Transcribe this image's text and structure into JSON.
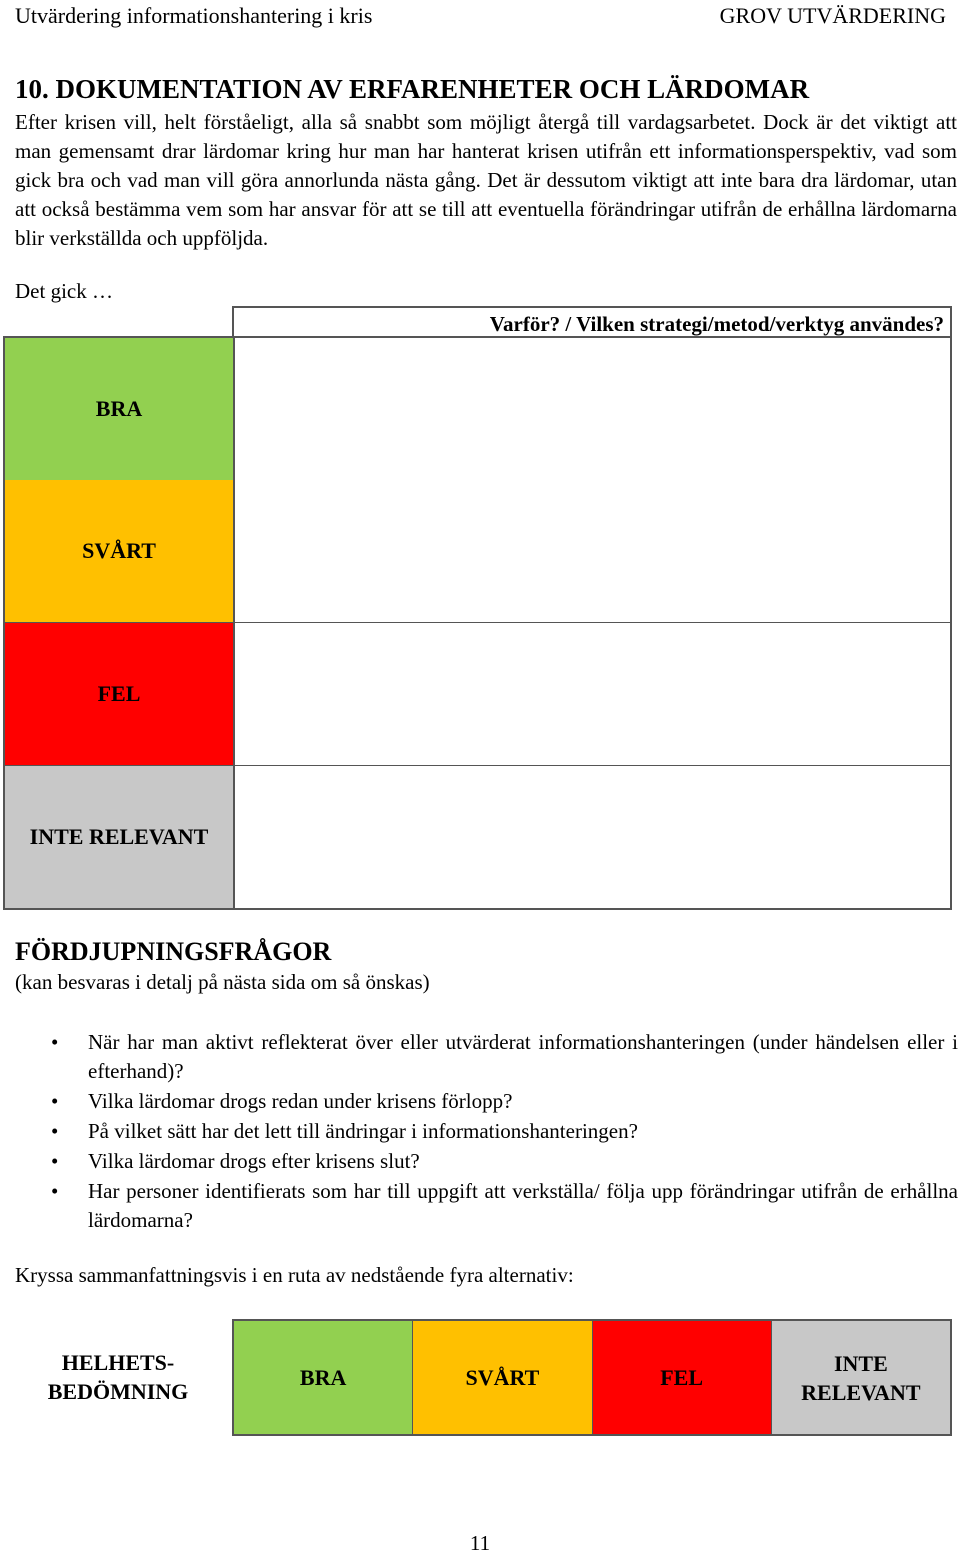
{
  "header": {
    "left": "Utvärdering informationshantering i kris",
    "right": "GROV UTVÄRDERING"
  },
  "section": {
    "title": "10. DOKUMENTATION AV ERFARENHETER OCH LÄRDOMAR",
    "intro": "Efter krisen vill, helt förståeligt, alla så snabbt som möjligt återgå till vardagsarbetet. Dock är det viktigt att man gemensamt drar lärdomar kring hur man har hanterat krisen utifrån ett informationsperspektiv, vad som gick bra och vad man vill göra annorlunda nästa gång. Det är dessutom viktigt att inte bara dra lärdomar, utan att också bestämma vem som har ansvar för att se till att eventuella förändringar utifrån de erhållna lärdomarna blir verkställda och uppföljda."
  },
  "table": {
    "intro_label": "Det gick …",
    "header": "Varför? / Vilken strategi/metod/verktyg användes?",
    "rows": [
      {
        "label": "BRA",
        "color": "#92D050",
        "answer": ""
      },
      {
        "label": "SVÅRT",
        "color": "#FFC000",
        "answer": ""
      },
      {
        "label": "FEL",
        "color": "#FF0000",
        "answer": ""
      },
      {
        "label": "INTE RELEVANT",
        "color": "#C8C8C8",
        "answer": ""
      }
    ]
  },
  "deepening": {
    "title": "FÖRDJUPNINGSFRÅGOR",
    "subtitle": "(kan besvaras i detalj på nästa sida om så önskas)",
    "bullet": "•",
    "questions": [
      "När har man aktivt reflekterat över eller utvärderat informationshanteringen (under händelsen eller i efterhand)?",
      "Vilka lärdomar drogs redan under krisens förlopp?",
      "På vilket sätt har det lett till ändringar i informationshanteringen?",
      "Vilka lärdomar drogs efter krisens slut?",
      "Har personer identifierats som har till uppgift att verkställa/ följa upp förändringar utifrån de erhållna lärdomarna?"
    ]
  },
  "summary": {
    "instruction": "Kryssa sammanfattningsvis i en ruta av nedstående fyra alternativ:",
    "label_line1": "HELHETS-",
    "label_line2": "BEDÖMNING",
    "options": [
      {
        "line1": "BRA",
        "line2": "",
        "color": "#92D050"
      },
      {
        "line1": "SVÅRT",
        "line2": "",
        "color": "#FFC000"
      },
      {
        "line1": "FEL",
        "line2": "",
        "color": "#FF0000"
      },
      {
        "line1": "INTE",
        "line2": "RELEVANT",
        "color": "#C8C8C8"
      }
    ]
  },
  "footer": {
    "page_number": "11"
  }
}
